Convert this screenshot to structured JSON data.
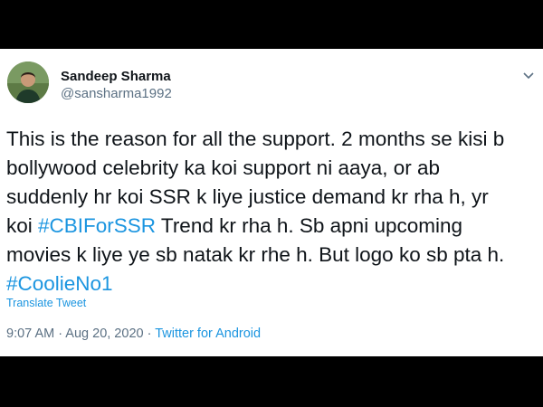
{
  "tweet": {
    "author": {
      "name": "Sandeep Sharma",
      "handle": "@sansharma1992"
    },
    "text": {
      "line1": "This is the reason for all the support. 2 months se kisi b",
      "line2": "bollywood celebrity ka koi support ni aaya, or ab",
      "line3": "suddenly hr koi SSR k liye justice demand kr rha h, yr",
      "line4_before": "koi ",
      "hashtag1": "#CBIForSSR",
      "line4_after": " Trend kr rha h. Sb apni upcoming",
      "line5": "movies k liye ye sb natak kr rhe h. But logo ko sb pta h.",
      "hashtag2": "#CoolieNo1"
    },
    "translate_label": "Translate Tweet",
    "time": "9:07 AM",
    "separator1": " · ",
    "date": "Aug 20, 2020",
    "separator2": " · ",
    "source": "Twitter for Android"
  },
  "colors": {
    "link": "#1b95e0",
    "text": "#0f1419",
    "muted": "#5b7083",
    "letterbox": "#000000"
  },
  "icons": {
    "avatar": "profile-photo",
    "menu": "chevron-down-icon"
  }
}
